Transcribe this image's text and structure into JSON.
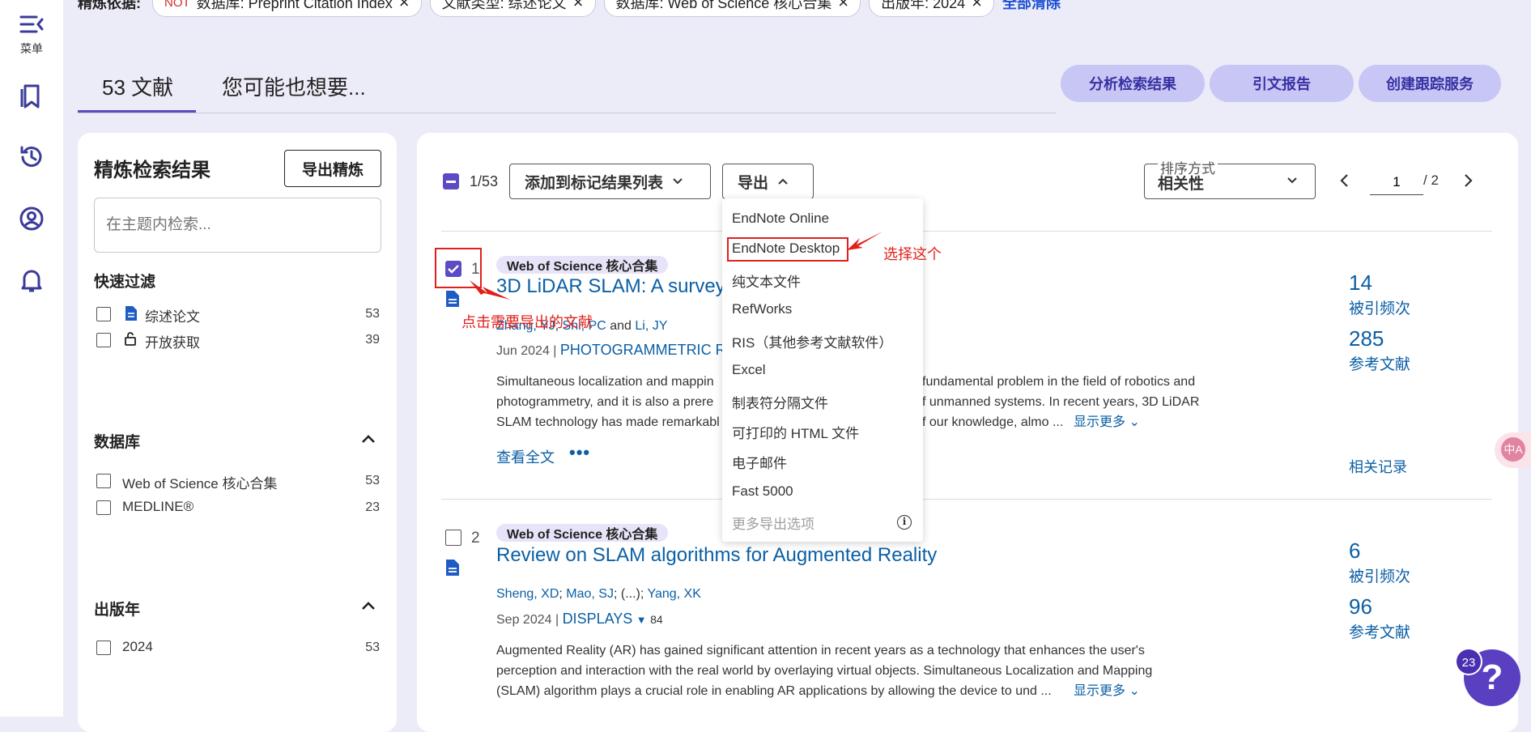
{
  "rail": {
    "menu_label": "菜单"
  },
  "filters": {
    "lead": "精炼依据:",
    "chips": [
      {
        "prefix": "NOT",
        "text": "数据库: Preprint Citation Index"
      },
      {
        "prefix": "",
        "text": "文献类型: 综述论文"
      },
      {
        "prefix": "",
        "text": "数据库: Web of Science 核心合集"
      },
      {
        "prefix": "",
        "text": "出版年: 2024"
      }
    ],
    "clear_all": "全部清除"
  },
  "tabs": {
    "count": "53",
    "docs": "文献",
    "suggest": "您可能也想要..."
  },
  "actions": {
    "analyze": "分析检索结果",
    "citation_report": "引文报告",
    "create_alert": "创建跟踪服务"
  },
  "refine": {
    "title": "精炼检索结果",
    "export_button": "导出精炼",
    "search_placeholder": "在主题内检索...",
    "quick_filter": {
      "title": "快速过滤",
      "items": [
        {
          "label": "综述论文",
          "count": "53"
        },
        {
          "label": "开放获取",
          "count": "39"
        }
      ]
    },
    "database": {
      "title": "数据库",
      "items": [
        {
          "label": "Web of Science 核心合集",
          "count": "53"
        },
        {
          "label": "MEDLINE®",
          "count": "23"
        }
      ]
    },
    "year": {
      "title": "出版年",
      "items": [
        {
          "label": "2024",
          "count": "53"
        }
      ]
    }
  },
  "toolbar": {
    "selected": "1/53",
    "add_to_marked": "添加到标记结果列表",
    "export": "导出",
    "sort_label": "排序方式",
    "sort_value": "相关性",
    "page_current": "1",
    "page_total": "/ 2"
  },
  "export_menu": {
    "items": [
      "EndNote Online",
      "EndNote Desktop",
      "纯文本文件",
      "RefWorks",
      "RIS（其他参考文献软件）",
      "Excel",
      "制表符分隔文件",
      "可打印的 HTML 文件",
      "电子邮件",
      "Fast 5000"
    ],
    "more": "更多导出选项"
  },
  "records": [
    {
      "num": "1",
      "badge": "Web of Science 核心合集",
      "title": "3D LiDAR SLAM: A survey",
      "authors": {
        "a1": "Zhang, YJ",
        "a2": "Shi, PC",
        "sep": "and",
        "a3": "Li, JY"
      },
      "date": "Jun 2024",
      "journal": "PHOTOGRAMMETRIC RE",
      "abstract_l1": "Simultaneous localization and mappin",
      "abstract_l1b": "fundamental problem in the field of robotics and",
      "abstract_l2": "photogrammetry, and it is also a prere",
      "abstract_l2b": "f unmanned systems. In recent years, 3D LiDAR",
      "abstract_l3": "SLAM technology has made remarkabl",
      "abstract_l3b": "f our knowledge, almo ...",
      "show_more": "显示更多",
      "full_text": "查看全文",
      "citations": "14",
      "citations_label": "被引频次",
      "references": "285",
      "references_label": "参考文献",
      "related": "相关记录"
    },
    {
      "num": "2",
      "badge": "Web of Science 核心合集",
      "title": "Review on SLAM algorithms for Augmented Reality",
      "authors": {
        "a1": "Sheng, XD",
        "a2": "Mao, SJ",
        "mid": "(...)",
        "a3": "Yang, XK"
      },
      "date": "Sep 2024",
      "journal": "DISPLAYS",
      "journal_count": "84",
      "abstract_l1": "Augmented Reality (AR) has gained significant attention in recent years as a technology that enhances the user's",
      "abstract_l2": "perception and interaction with the real world by overlaying virtual objects. Simultaneous Localization and Mapping",
      "abstract_l3": "(SLAM) algorithm plays a crucial role in enabling AR applications by allowing the device to und ...",
      "show_more": "显示更多",
      "citations": "6",
      "citations_label": "被引频次",
      "references": "96",
      "references_label": "参考文献"
    }
  ],
  "annotations": {
    "select_this": "选择这个",
    "click_export": "点击需要导出的文献"
  },
  "help": {
    "badge": "23",
    "symbol": "?"
  },
  "translate_glyph": "中A",
  "colors": {
    "accent": "#5b4bc4",
    "link": "#0b5fa5",
    "annotation": "#e0201b",
    "pill_bg": "#c8c6f5"
  }
}
